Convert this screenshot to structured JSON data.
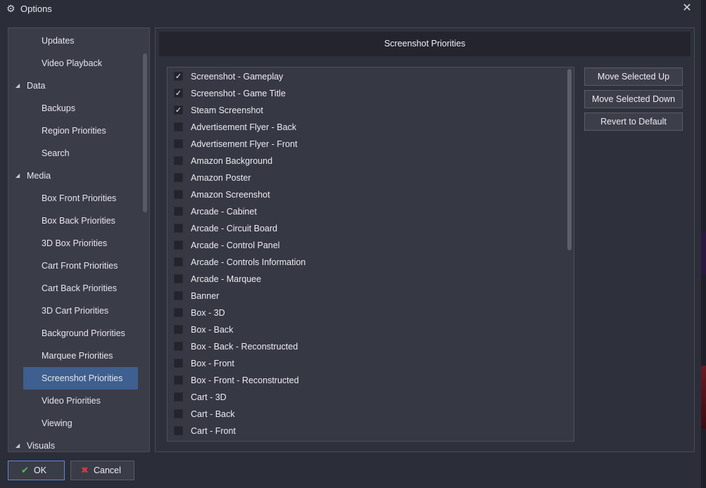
{
  "window": {
    "title": "Options",
    "icon": "gear-icon",
    "close_icon": "close-icon"
  },
  "sidebar": {
    "items": [
      {
        "label": "Updates",
        "type": "child"
      },
      {
        "label": "Video Playback",
        "type": "child"
      },
      {
        "label": "Data",
        "type": "category",
        "expanded": true
      },
      {
        "label": "Backups",
        "type": "child"
      },
      {
        "label": "Region Priorities",
        "type": "child"
      },
      {
        "label": "Search",
        "type": "child"
      },
      {
        "label": "Media",
        "type": "category",
        "expanded": true
      },
      {
        "label": "Box Front Priorities",
        "type": "child"
      },
      {
        "label": "Box Back Priorities",
        "type": "child"
      },
      {
        "label": "3D Box Priorities",
        "type": "child"
      },
      {
        "label": "Cart Front Priorities",
        "type": "child"
      },
      {
        "label": "Cart Back Priorities",
        "type": "child"
      },
      {
        "label": "3D Cart Priorities",
        "type": "child"
      },
      {
        "label": "Background Priorities",
        "type": "child"
      },
      {
        "label": "Marquee Priorities",
        "type": "child"
      },
      {
        "label": "Screenshot Priorities",
        "type": "child",
        "selected": true
      },
      {
        "label": "Video Priorities",
        "type": "child"
      },
      {
        "label": "Viewing",
        "type": "child"
      },
      {
        "label": "Visuals",
        "type": "category",
        "expanded": true
      }
    ]
  },
  "main": {
    "header": "Screenshot Priorities",
    "list": [
      {
        "label": "Screenshot - Gameplay",
        "checked": true
      },
      {
        "label": "Screenshot - Game Title",
        "checked": true
      },
      {
        "label": "Steam Screenshot",
        "checked": true
      },
      {
        "label": "Advertisement Flyer - Back",
        "checked": false
      },
      {
        "label": "Advertisement Flyer - Front",
        "checked": false
      },
      {
        "label": "Amazon Background",
        "checked": false
      },
      {
        "label": "Amazon Poster",
        "checked": false
      },
      {
        "label": "Amazon Screenshot",
        "checked": false
      },
      {
        "label": "Arcade - Cabinet",
        "checked": false
      },
      {
        "label": "Arcade - Circuit Board",
        "checked": false
      },
      {
        "label": "Arcade - Control Panel",
        "checked": false
      },
      {
        "label": "Arcade - Controls Information",
        "checked": false
      },
      {
        "label": "Arcade - Marquee",
        "checked": false
      },
      {
        "label": "Banner",
        "checked": false
      },
      {
        "label": "Box - 3D",
        "checked": false
      },
      {
        "label": "Box - Back",
        "checked": false
      },
      {
        "label": "Box - Back - Reconstructed",
        "checked": false
      },
      {
        "label": "Box - Front",
        "checked": false
      },
      {
        "label": "Box - Front - Reconstructed",
        "checked": false
      },
      {
        "label": "Cart - 3D",
        "checked": false
      },
      {
        "label": "Cart - Back",
        "checked": false
      },
      {
        "label": "Cart - Front",
        "checked": false
      }
    ],
    "buttons": {
      "move_up": "Move Selected Up",
      "move_down": "Move Selected Down",
      "revert": "Revert to Default"
    }
  },
  "footer": {
    "ok": "OK",
    "cancel": "Cancel"
  },
  "colors": {
    "selection": "#3e5f8f",
    "ok_check": "#4cc24c",
    "cancel_x": "#d83a3a"
  }
}
